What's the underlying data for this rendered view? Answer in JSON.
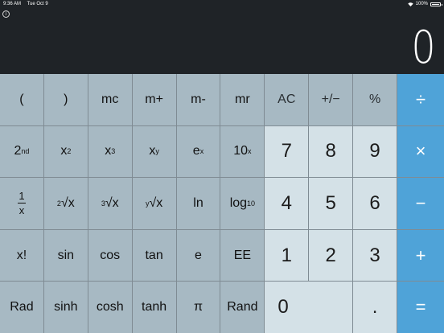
{
  "status_bar": {
    "time": "9:36 AM",
    "date": "Tue Oct 9",
    "battery": "100%"
  },
  "display": {
    "value": "0"
  },
  "keys": {
    "row1": [
      "(",
      ")",
      "mc",
      "m+",
      "m-",
      "mr",
      "AC",
      "+/−",
      "%",
      "÷"
    ],
    "row2": [
      "2nd",
      "x²",
      "x³",
      "xʸ",
      "eˣ",
      "10ˣ",
      "7",
      "8",
      "9",
      "×"
    ],
    "row3": [
      "1/x",
      "²√x",
      "³√x",
      "ʸ√x",
      "ln",
      "log10",
      "4",
      "5",
      "6",
      "−"
    ],
    "row4": [
      "x!",
      "sin",
      "cos",
      "tan",
      "e",
      "EE",
      "1",
      "2",
      "3",
      "+"
    ],
    "row5": [
      "Rad",
      "sinh",
      "cosh",
      "tanh",
      "π",
      "Rand",
      "0",
      ".",
      "="
    ]
  },
  "labels": {
    "two_base": "2",
    "nd": "nd",
    "x": "x",
    "two": "2",
    "three": "3",
    "y": "y",
    "e": "e",
    "ten": "10",
    "one": "1",
    "ln": "ln",
    "log": "log",
    "ten_sub": "10",
    "sqrt": "√x"
  },
  "colors": {
    "operator": "#4fa3d8",
    "number_key": "#d4e1e7",
    "function_key": "#a7b9c3",
    "background": "#1f2327"
  }
}
